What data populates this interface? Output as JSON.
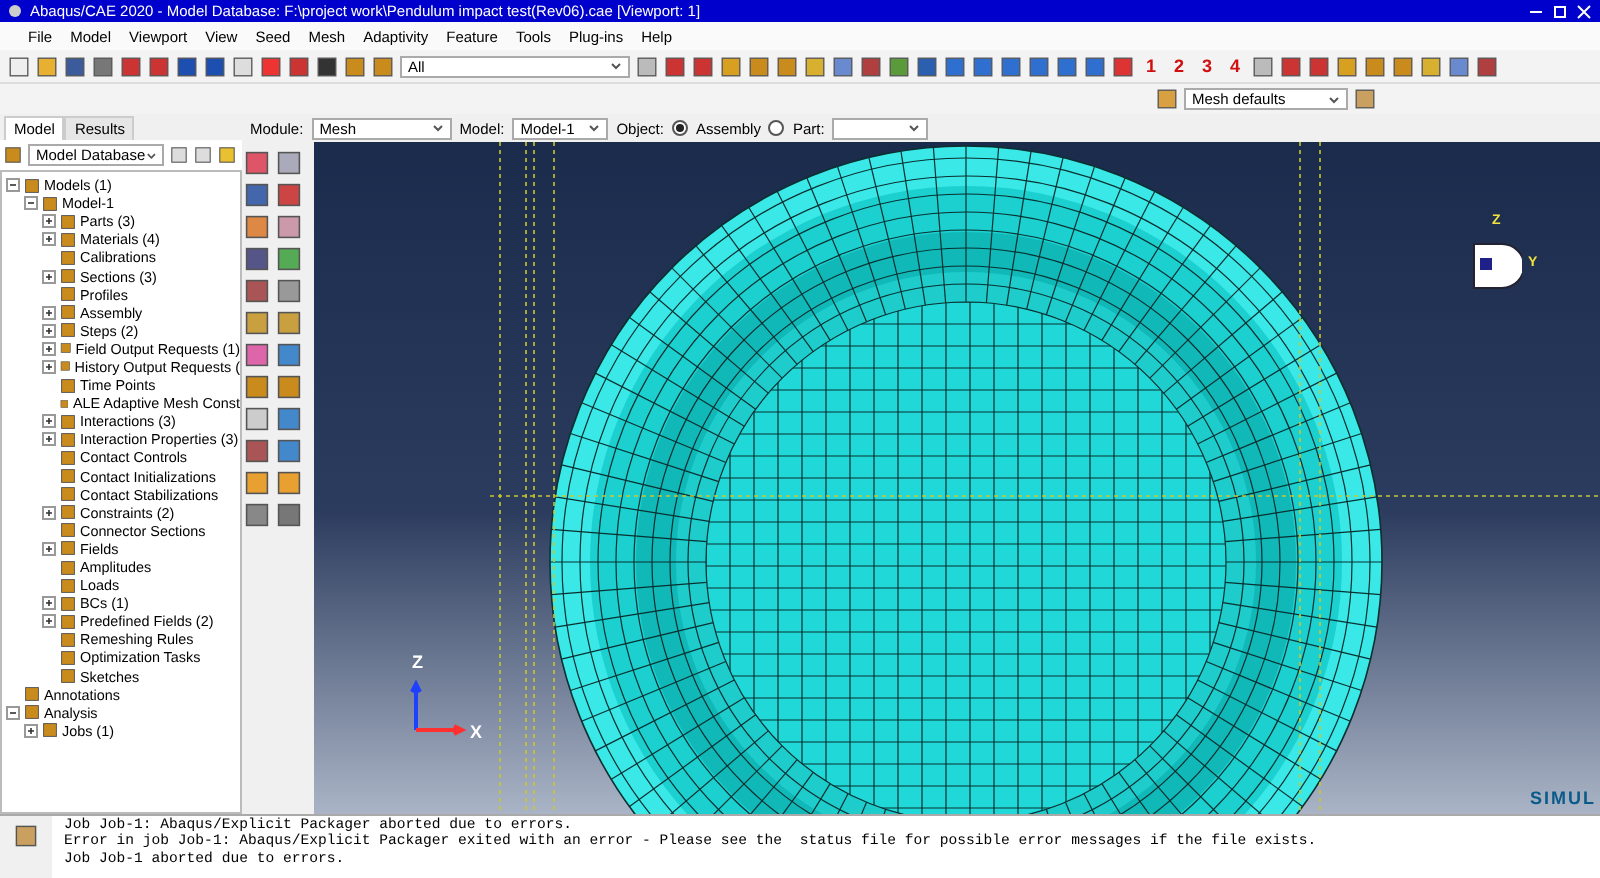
{
  "window": {
    "title": "Abaqus/CAE 2020 - Model Database: F:\\project work\\Pendulum impact test(Rev06).cae [Viewport: 1]"
  },
  "menu": [
    "File",
    "Model",
    "Viewport",
    "View",
    "Seed",
    "Mesh",
    "Adaptivity",
    "Feature",
    "Tools",
    "Plug-ins",
    "Help"
  ],
  "toolbar": {
    "selection_filter": "All",
    "view_numbers": [
      "1",
      "2",
      "3",
      "4"
    ],
    "mesh_defaults": "Mesh defaults"
  },
  "module_bar": {
    "module_label": "Module:",
    "module": "Mesh",
    "model_label": "Model:",
    "model": "Model-1",
    "object_label": "Object:",
    "objects": [
      {
        "label": "Assembly",
        "selected": true
      },
      {
        "label": "Part:",
        "selected": false
      }
    ]
  },
  "tabs": [
    {
      "label": "Model",
      "selected": true
    },
    {
      "label": "Results",
      "selected": false
    }
  ],
  "tree_source": "Model Database",
  "tree": [
    {
      "label": "Models (1)",
      "expanded": true,
      "children": [
        {
          "label": "Model-1",
          "expanded": true,
          "children": [
            {
              "label": "Parts (3)",
              "expanded": false
            },
            {
              "label": "Materials (4)",
              "expanded": false
            },
            {
              "label": "Calibrations"
            },
            {
              "label": "Sections (3)",
              "expanded": false
            },
            {
              "label": "Profiles"
            },
            {
              "label": "Assembly",
              "expanded": false
            },
            {
              "label": "Steps (2)",
              "expanded": false
            },
            {
              "label": "Field Output Requests (1)",
              "expanded": false
            },
            {
              "label": "History Output Requests (",
              "expanded": false
            },
            {
              "label": "Time Points"
            },
            {
              "label": "ALE Adaptive Mesh Const"
            },
            {
              "label": "Interactions (3)",
              "expanded": false
            },
            {
              "label": "Interaction Properties (3)",
              "expanded": false
            },
            {
              "label": "Contact Controls"
            },
            {
              "label": "Contact Initializations"
            },
            {
              "label": "Contact Stabilizations"
            },
            {
              "label": "Constraints (2)",
              "expanded": false
            },
            {
              "label": "Connector Sections"
            },
            {
              "label": "Fields",
              "expanded": false
            },
            {
              "label": "Amplitudes"
            },
            {
              "label": "Loads"
            },
            {
              "label": "BCs (1)",
              "expanded": false
            },
            {
              "label": "Predefined Fields (2)",
              "expanded": false
            },
            {
              "label": "Remeshing Rules"
            },
            {
              "label": "Optimization Tasks"
            },
            {
              "label": "Sketches"
            }
          ]
        }
      ]
    },
    {
      "label": "Annotations"
    },
    {
      "label": "Analysis",
      "expanded": true,
      "children": [
        {
          "label": "Jobs (1)",
          "expanded": false
        }
      ]
    }
  ],
  "viewport": {
    "triad": [
      "Z",
      "X"
    ],
    "view_cube": [
      "Z",
      "Y"
    ],
    "logo": "SIMUL"
  },
  "messages": [
    "Job Job-1: Abaqus/Explicit Packager aborted due to errors.",
    "Error in job Job-1: Abaqus/Explicit Packager exited with an error - Please see the  status file for possible error messages if the file exists.",
    "Job Job-1 aborted due to errors."
  ]
}
